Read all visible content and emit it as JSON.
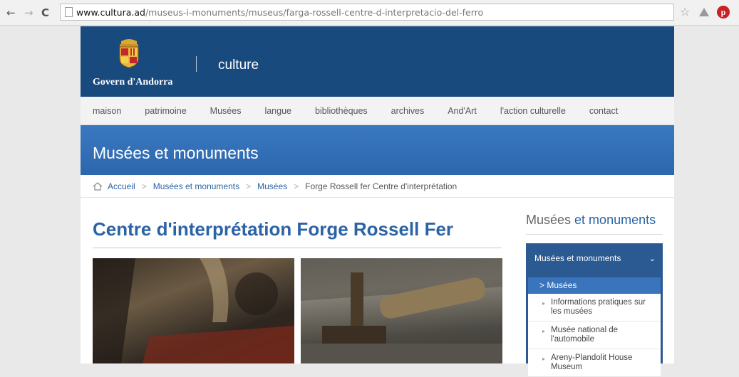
{
  "browser": {
    "back": "←",
    "forward": "→",
    "reload": "C",
    "url_host": "www.cultura.ad",
    "url_path": "/museus-i-monuments/museus/farga-rossell-centre-d-interpretacio-del-ferro",
    "pinterest_glyph": "p"
  },
  "header": {
    "gov_name": "Govern d'Andorra",
    "section": "culture"
  },
  "nav": [
    "maison",
    "patrimoine",
    "Musées",
    "langue",
    "bibliothèques",
    "archives",
    "And'Art",
    "l'action culturelle",
    "contact"
  ],
  "banner": {
    "title": "Musées et monuments"
  },
  "breadcrumb": {
    "home": "Accueil",
    "level1": "Musées et monuments",
    "level2": "Musées",
    "current": "Forge Rossell fer Centre d'interprétation",
    "separator": ">"
  },
  "main": {
    "title": "Centre d'interprétation Forge Rossell Fer"
  },
  "aside": {
    "title_plain": "Musées",
    "title_accent": "et monuments",
    "head": "Musées et monuments",
    "active": "Musées",
    "active_prefix": ">",
    "items": [
      "Informations pratiques sur les musées",
      "Musée national de l'automobile",
      "Areny-Plandolit House Museum"
    ]
  },
  "colors": {
    "header_bg": "#184a7e",
    "banner_bg": "#3a78c0",
    "link": "#2b63a5",
    "aside_bg": "#2b5a92"
  }
}
